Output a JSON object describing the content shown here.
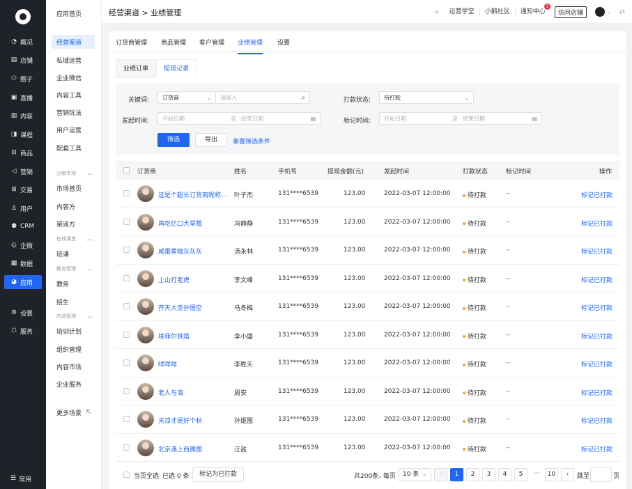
{
  "nav": {
    "items": [
      {
        "icon": "◔",
        "label": "概况"
      },
      {
        "icon": "▤",
        "label": "店铺"
      },
      {
        "icon": "⚇",
        "label": "圈子"
      },
      {
        "icon": "▣",
        "label": "直播"
      },
      {
        "icon": "▥",
        "label": "内容"
      },
      {
        "icon": "◨",
        "label": "课程"
      },
      {
        "icon": "⊟",
        "label": "商品"
      },
      {
        "icon": "◁",
        "label": "营销"
      },
      {
        "icon": "⊞",
        "label": "交易"
      },
      {
        "icon": "♙",
        "label": "用户"
      },
      {
        "icon": "⚉",
        "label": "CRM"
      },
      {
        "icon": "◵",
        "label": "企微"
      },
      {
        "icon": "▦",
        "label": "数据"
      },
      {
        "icon": "◕",
        "label": "应用"
      },
      {
        "icon": "⚙",
        "label": "设置"
      },
      {
        "icon": "☖",
        "label": "服务"
      }
    ],
    "bottom": {
      "icon": "☰",
      "label": "常用"
    }
  },
  "subnav": {
    "items": [
      "应用首页",
      "经营渠道",
      "私域运营",
      "企业微信",
      "内容工具",
      "营销玩法",
      "用户运营",
      "配套工具"
    ],
    "groups": [
      {
        "title": "分销市场",
        "items": [
          "市场首页",
          "内容方",
          "渠道方"
        ]
      },
      {
        "title": "在线课堂",
        "items": [
          "班课"
        ]
      },
      {
        "title": "教务管理",
        "items": [
          "教务",
          "招生"
        ]
      },
      {
        "title": "内训管理",
        "items": [
          "培训计划",
          "组织管理",
          "内容市场",
          "企业服务"
        ]
      }
    ],
    "more": "更多场景"
  },
  "topbar": {
    "breadcrumb": "经营渠道 > 业绩管理",
    "links": [
      "运营学堂",
      "小鹅社区",
      "通知中心"
    ],
    "notify_count": "3",
    "visit": "访问店铺"
  },
  "tabs": [
    "订货商管理",
    "商品管理",
    "客户管理",
    "业绩管理",
    "设置"
  ],
  "subtabs": [
    "业绩订单",
    "提现记录"
  ],
  "filter": {
    "keyword_label": "关键词:",
    "keyword_type": "订货商",
    "keyword_placeholder": "请输入",
    "pay_status_label": "打款状态:",
    "pay_status_value": "待打款",
    "start_label": "发起时间:",
    "mark_label": "标记时间:",
    "start_date_ph": "开始日期",
    "to": "至",
    "end_date_ph": "结束日期",
    "filter_btn": "筛选",
    "export_btn": "导出",
    "reset": "重置筛选条件"
  },
  "table": {
    "headers": [
      "订货商",
      "姓名",
      "手机号",
      "提现金额(元)",
      "发起时间",
      "打款状态",
      "标记时间",
      "操作"
    ],
    "rows": [
      {
        "dealer": "这是个超长订货商昵称...",
        "name": "叶子杰",
        "phone": "131****6539",
        "amount": "123.00",
        "time": "2022-03-07 12:00:00",
        "status": "待打款",
        "mark": "--",
        "action": "标记已打款"
      },
      {
        "dealer": "再吃亿口大草莓",
        "name": "冯静静",
        "phone": "131****6539",
        "amount": "123.00",
        "time": "2022-03-07 12:00:00",
        "status": "待打款",
        "mark": "--",
        "action": "标记已打款"
      },
      {
        "dealer": "咸蛋黄咖灰灰灰",
        "name": "汤永林",
        "phone": "131****6539",
        "amount": "123.00",
        "time": "2022-03-07 12:00:00",
        "status": "待打款",
        "mark": "--",
        "action": "标记已打款"
      },
      {
        "dealer": "上山打老虎",
        "name": "李文峰",
        "phone": "131****6539",
        "amount": "123.00",
        "time": "2022-03-07 12:00:00",
        "status": "待打款",
        "mark": "--",
        "action": "标记已打款"
      },
      {
        "dealer": "齐天大圣孙悟空",
        "name": "马冬梅",
        "phone": "131****6539",
        "amount": "123.00",
        "time": "2022-03-07 12:00:00",
        "status": "待打款",
        "mark": "--",
        "action": "标记已打款"
      },
      {
        "dealer": "埃菲尔铁塔",
        "name": "李小盛",
        "phone": "131****6539",
        "amount": "123.00",
        "time": "2022-03-07 12:00:00",
        "status": "待打款",
        "mark": "--",
        "action": "标记已打款"
      },
      {
        "dealer": "咩咩咩",
        "name": "李胜天",
        "phone": "131****6539",
        "amount": "123.00",
        "time": "2022-03-07 12:00:00",
        "status": "待打款",
        "mark": "--",
        "action": "标记已打款"
      },
      {
        "dealer": "老人与海",
        "name": "周安",
        "phone": "131****6539",
        "amount": "123.00",
        "time": "2022-03-07 12:00:00",
        "status": "待打款",
        "mark": "--",
        "action": "标记已打款"
      },
      {
        "dealer": "天凉才是好个秋",
        "name": "孙姬图",
        "phone": "131****6539",
        "amount": "123.00",
        "time": "2022-03-07 12:00:00",
        "status": "待打款",
        "mark": "--",
        "action": "标记已打款"
      },
      {
        "dealer": "北京遇上西雅图",
        "name": "汪盐",
        "phone": "131****6539",
        "amount": "123.00",
        "time": "2022-03-07 12:00:00",
        "status": "待打款",
        "mark": "--",
        "action": "标记已打款"
      }
    ]
  },
  "footer": {
    "select_all": "当页全选",
    "selected": "已选 0 条",
    "mark_btn": "标记为已打款",
    "total": "共200条，",
    "per_page_label": "每页",
    "per_page": "10 条",
    "pages": [
      "1",
      "2",
      "3",
      "4",
      "5",
      "···",
      "10"
    ],
    "goto_label": "跳至",
    "page_unit": "页"
  }
}
